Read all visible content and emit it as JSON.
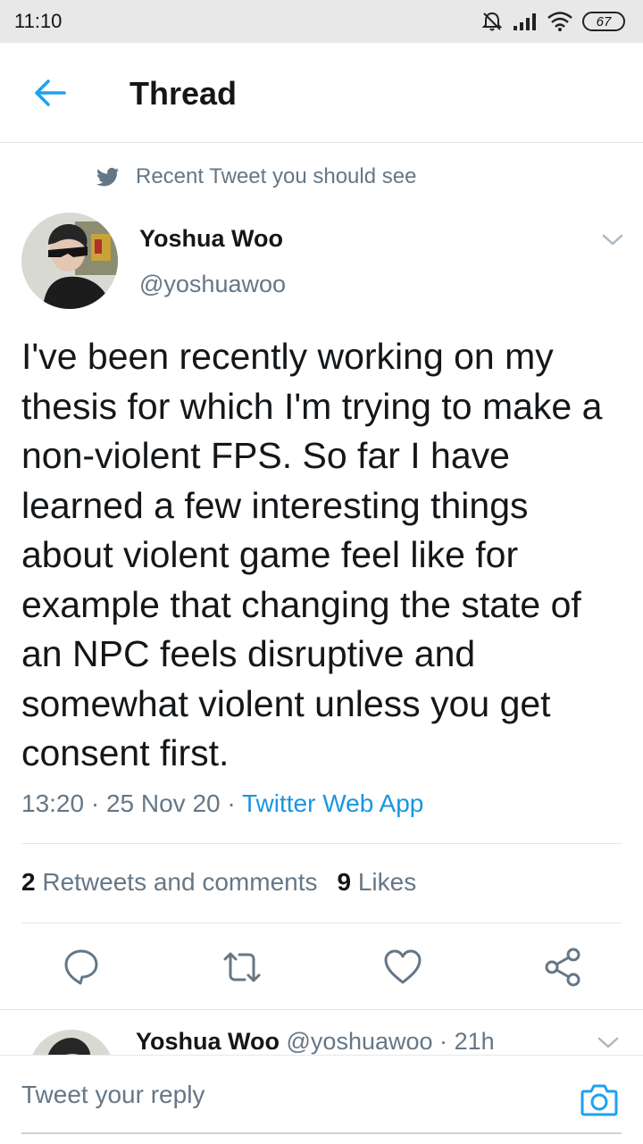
{
  "status_bar": {
    "time": "11:10",
    "battery": "67",
    "icons": [
      "alarm-off-icon",
      "signal-icon",
      "wifi-icon",
      "battery-icon"
    ]
  },
  "header": {
    "title": "Thread",
    "back_icon": "back-arrow-icon"
  },
  "context": {
    "icon": "twitter-bird-icon",
    "label": "Recent Tweet you should see"
  },
  "tweet": {
    "author_name": "Yoshua Woo",
    "author_handle": "@yoshuawoo",
    "text": "I've been recently working on my thesis for which I'm trying to make a non-violent FPS. So far I have learned a few interesting things about violent game feel like for example that changing the state of an NPC feels disruptive and somewhat violent unless you get consent first.",
    "time": "13:20",
    "separator": "·",
    "date": "25 Nov 20",
    "source": "Twitter Web App",
    "retweets_count": "2",
    "retweets_label": "Retweets and comments",
    "likes_count": "9",
    "likes_label": "Likes"
  },
  "actions": [
    "reply-icon",
    "retweet-icon",
    "like-icon",
    "share-icon"
  ],
  "next_reply": {
    "author_name": "Yoshua Woo",
    "author_handle": "@yoshuawoo",
    "separator": "·",
    "time": "21h"
  },
  "composer": {
    "placeholder": "Tweet your reply",
    "camera_icon": "camera-icon"
  },
  "colors": {
    "accent": "#1da1f2",
    "link": "#1b95e0",
    "secondary_text": "#657786",
    "primary_text": "#14171a",
    "divider": "#e1e8ed"
  }
}
